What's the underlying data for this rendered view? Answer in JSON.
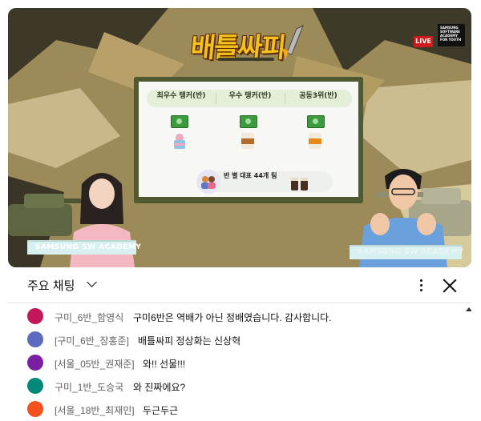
{
  "video": {
    "title_logo": "배틀싸피",
    "live_badge": "LIVE",
    "brand_logo": "SAMSUNG SOFTWARE ACADEMY FOR YOUTH",
    "slide": {
      "categories": [
        "최우수 탱커(반)",
        "우수 탱커(반)",
        "공동3위(반)"
      ],
      "bottom_label": "반 별 대표 44개 팀"
    },
    "desk_left_label": "SAMSUNG SW ACADEMY",
    "desk_right_label": "SAMSUNG SW ACADEMY"
  },
  "chat": {
    "title": "주요 채팅",
    "messages": [
      {
        "author": "구미_6반_함영식",
        "text": "구미6반은 역배가 아닌 정배였습니다. 감사합니다.",
        "avatar_color": "#c2185b"
      },
      {
        "author": "[구미_6반_장홍준]",
        "text": "배틀싸피 정상화는 신상혁",
        "avatar_color": "#5c6bc0"
      },
      {
        "author": "[서울_05반_권재준]",
        "text": "와!! 선물!!!",
        "avatar_color": "#7b1fa2"
      },
      {
        "author": "구미_1반_도승국",
        "text": "와 진짜에요?",
        "avatar_color": "#00897b"
      },
      {
        "author": "[서울_18반_최재민]",
        "text": "두근두근",
        "avatar_color": "#f4511e"
      }
    ]
  }
}
